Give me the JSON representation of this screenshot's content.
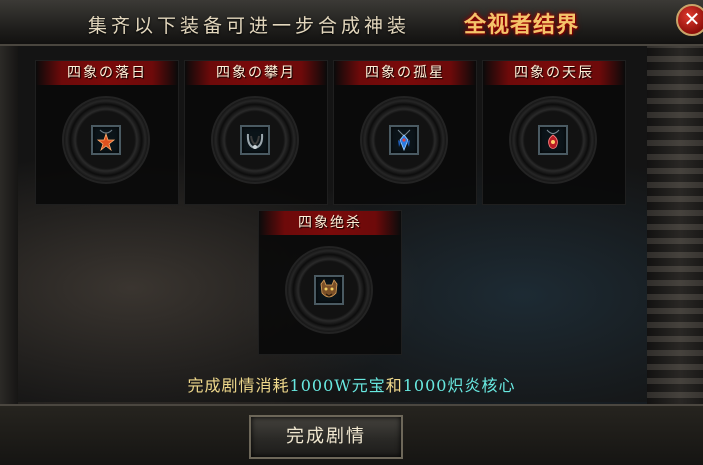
{
  "header": {
    "title": "集齐以下装备可进一步合成神装",
    "highlight": "全视者结界",
    "close_label": "✕"
  },
  "items": [
    {
      "name": "四象の落日",
      "icon": "orange-star-pendant-icon"
    },
    {
      "name": "四象の攀月",
      "icon": "dark-horn-necklace-icon"
    },
    {
      "name": "四象の孤星",
      "icon": "blue-gem-pendant-icon"
    },
    {
      "name": "四象の天辰",
      "icon": "red-gem-pendant-icon"
    },
    {
      "name": "四象绝杀",
      "icon": "demon-mask-icon"
    }
  ],
  "footer": {
    "part1": "完成剧情消耗",
    "cost1": "1000W元宝",
    "connector": "和",
    "cost2": "1000炽炎核心"
  },
  "button": {
    "label": "完成剧情"
  },
  "colors": {
    "highlight": "#f4c46a",
    "footer_text": "#f0d98c",
    "footer_cost": "#68e8e0",
    "banner_red": "#7a0a0a",
    "close_red": "#c0221a"
  }
}
